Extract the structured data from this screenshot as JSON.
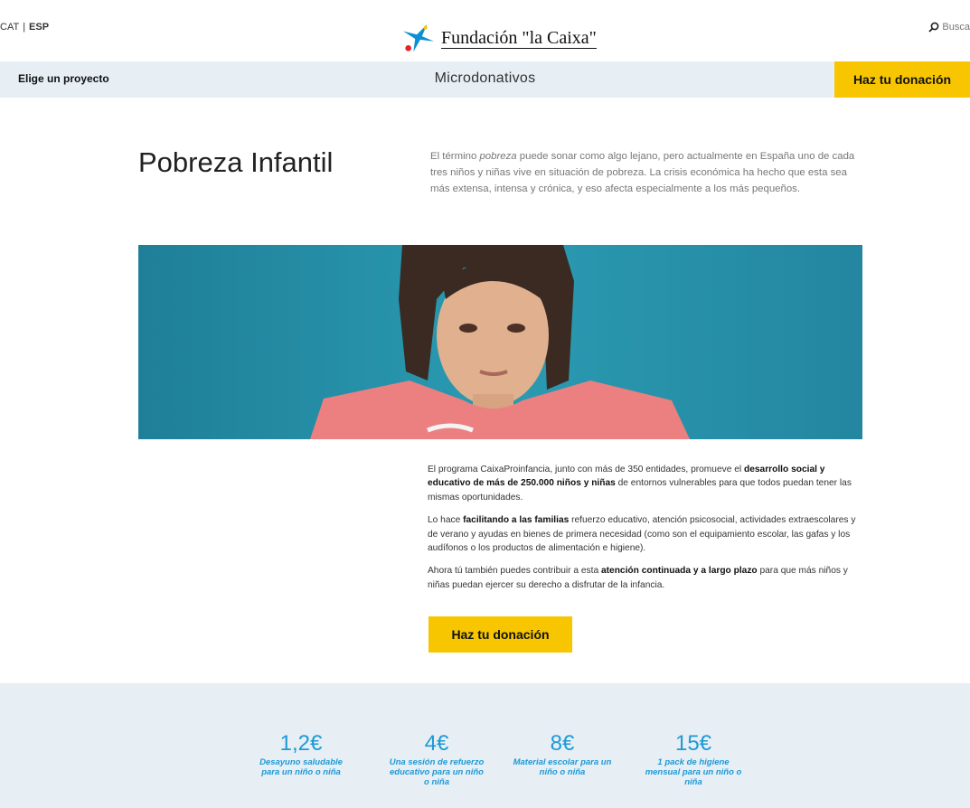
{
  "header": {
    "lang_cat": "CAT",
    "lang_sep": "|",
    "lang_esp": "ESP",
    "logo_text": "Fundación \"la Caixa\"",
    "search_label": "Busca"
  },
  "nav": {
    "project_label": "Elige un proyecto",
    "title": "Microdonativos",
    "donate_label": "Haz tu donación"
  },
  "intro": {
    "title": "Pobreza Infantil",
    "text_before": "El término ",
    "text_em": "pobreza",
    "text_after": " puede sonar como algo lejano, pero actualmente en España uno de cada tres niños y niñas vive en situación de pobreza. La crisis económica ha hecho que esta sea más extensa, intensa y crónica, y eso afecta especialmente a los más pequeños."
  },
  "body": {
    "p1_a": "El programa CaixaProinfancia, junto con más de 350 entidades, promueve el ",
    "p1_b": "desarrollo social y educativo de más de 250.000 niños y niñas",
    "p1_c": " de entornos vulnerables para que todos puedan tener las mismas oportunidades.",
    "p2_a": "Lo hace ",
    "p2_b": "facilitando a las familias",
    "p2_c": " refuerzo educativo, atención psicosocial, actividades extraescolares y de verano y ayudas en bienes de primera necesidad (como son el equipamiento escolar, las gafas y los audífonos o los productos de alimentación e higiene).",
    "p3_a": "Ahora tú también puedes contribuir a esta ",
    "p3_b": "atención continuada y a largo plazo",
    "p3_c": " para que más niños y niñas puedan ejercer su derecho a disfrutar de la infancia.",
    "cta_label": "Haz tu donación"
  },
  "donations": [
    {
      "amount": "1,2€",
      "desc": "Desayuno saludable para un niño o niña"
    },
    {
      "amount": "4€",
      "desc": "Una sesión de refuerzo educativo para un niño o niña"
    },
    {
      "amount": "8€",
      "desc": "Material escolar para un niño o niña"
    },
    {
      "amount": "15€",
      "desc": "1 pack de higiene mensual para un niño o niña"
    }
  ],
  "colors": {
    "accent_yellow": "#f7c600",
    "nav_bg": "#e7eef4",
    "donation_blue": "#1d9ad6",
    "hero_sky": "#2a95ab"
  }
}
